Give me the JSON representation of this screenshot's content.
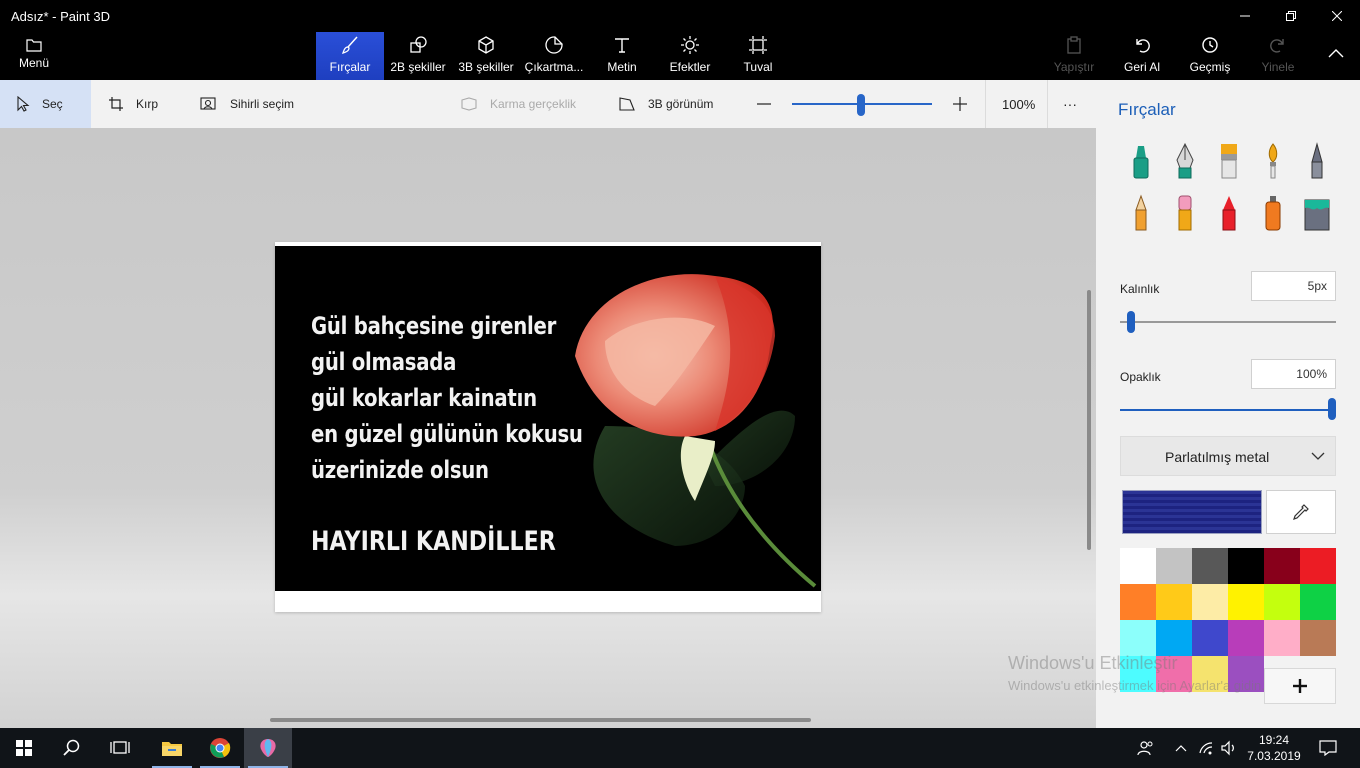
{
  "window": {
    "title": "Adsız* - Paint 3D"
  },
  "ribbon": {
    "menu_label": "Menü",
    "tools": [
      {
        "label": "Fırçalar",
        "icon": "brush-icon",
        "active": true
      },
      {
        "label": "2B şekiller",
        "icon": "2d-shapes-icon"
      },
      {
        "label": "3B şekiller",
        "icon": "3d-shapes-icon"
      },
      {
        "label": "Çıkartma...",
        "icon": "sticker-icon"
      },
      {
        "label": "Metin",
        "icon": "text-icon"
      },
      {
        "label": "Efektler",
        "icon": "effects-icon"
      },
      {
        "label": "Tuval",
        "icon": "canvas-icon"
      }
    ],
    "actions": [
      {
        "label": "Yapıştır",
        "icon": "paste-icon",
        "disabled": true
      },
      {
        "label": "Geri Al",
        "icon": "undo-icon"
      },
      {
        "label": "Geçmiş",
        "icon": "history-icon"
      },
      {
        "label": "Yinele",
        "icon": "redo-icon",
        "disabled": true
      }
    ]
  },
  "toolbar": {
    "select": "Seç",
    "crop": "Kırp",
    "magic_select": "Sihirli seçim",
    "mixed_reality": "Karma gerçeklik",
    "view_3d": "3B görünüm",
    "zoom": "100%",
    "more": "···"
  },
  "canvas": {
    "poem": [
      "Gül bahçesine girenler",
      "gül olmasada",
      "gül kokarlar kainatın",
      "en güzel gülünün kokusu",
      "üzerinizde olsun"
    ],
    "greeting": "HAYIRLI KANDİLLER"
  },
  "watermark": {
    "line1": "Windows'u Etkinleştir",
    "line2": "Windows'u etkinleştirmek için Ayarlar'a gidin."
  },
  "panel": {
    "title": "Fırçalar",
    "brushes": [
      "marker-icon",
      "calligraphy-pen-icon",
      "oil-brush-icon",
      "watercolor-icon",
      "pixel-pen-icon",
      "pencil-icon",
      "eraser-icon",
      "crayon-icon",
      "spray-can-icon",
      "fill-bucket-icon"
    ],
    "thickness_label": "Kalınlık",
    "thickness_value": "5px",
    "thickness": 0.05,
    "opacity_label": "Opaklık",
    "opacity_value": "100%",
    "opacity": 1.0,
    "material": "Parlatılmış metal",
    "current_color": "#2b3495",
    "palette": [
      "#ffffff",
      "#c3c3c3",
      "#585858",
      "#000000",
      "#88001b",
      "#ec1c24",
      "#ff7f27",
      "#ffca18",
      "#fdeca6",
      "#fff200",
      "#c4ff0e",
      "#0ed145",
      "#8cfffb",
      "#00a8f3",
      "#3f48cc",
      "#b83dba",
      "#ffaec8",
      "#b97a56",
      "#4dfcff",
      "#f06eaa",
      "#f5e36e",
      "#9b4fc0"
    ]
  },
  "taskbar": {
    "time": "19:24",
    "date": "7.03.2019"
  }
}
